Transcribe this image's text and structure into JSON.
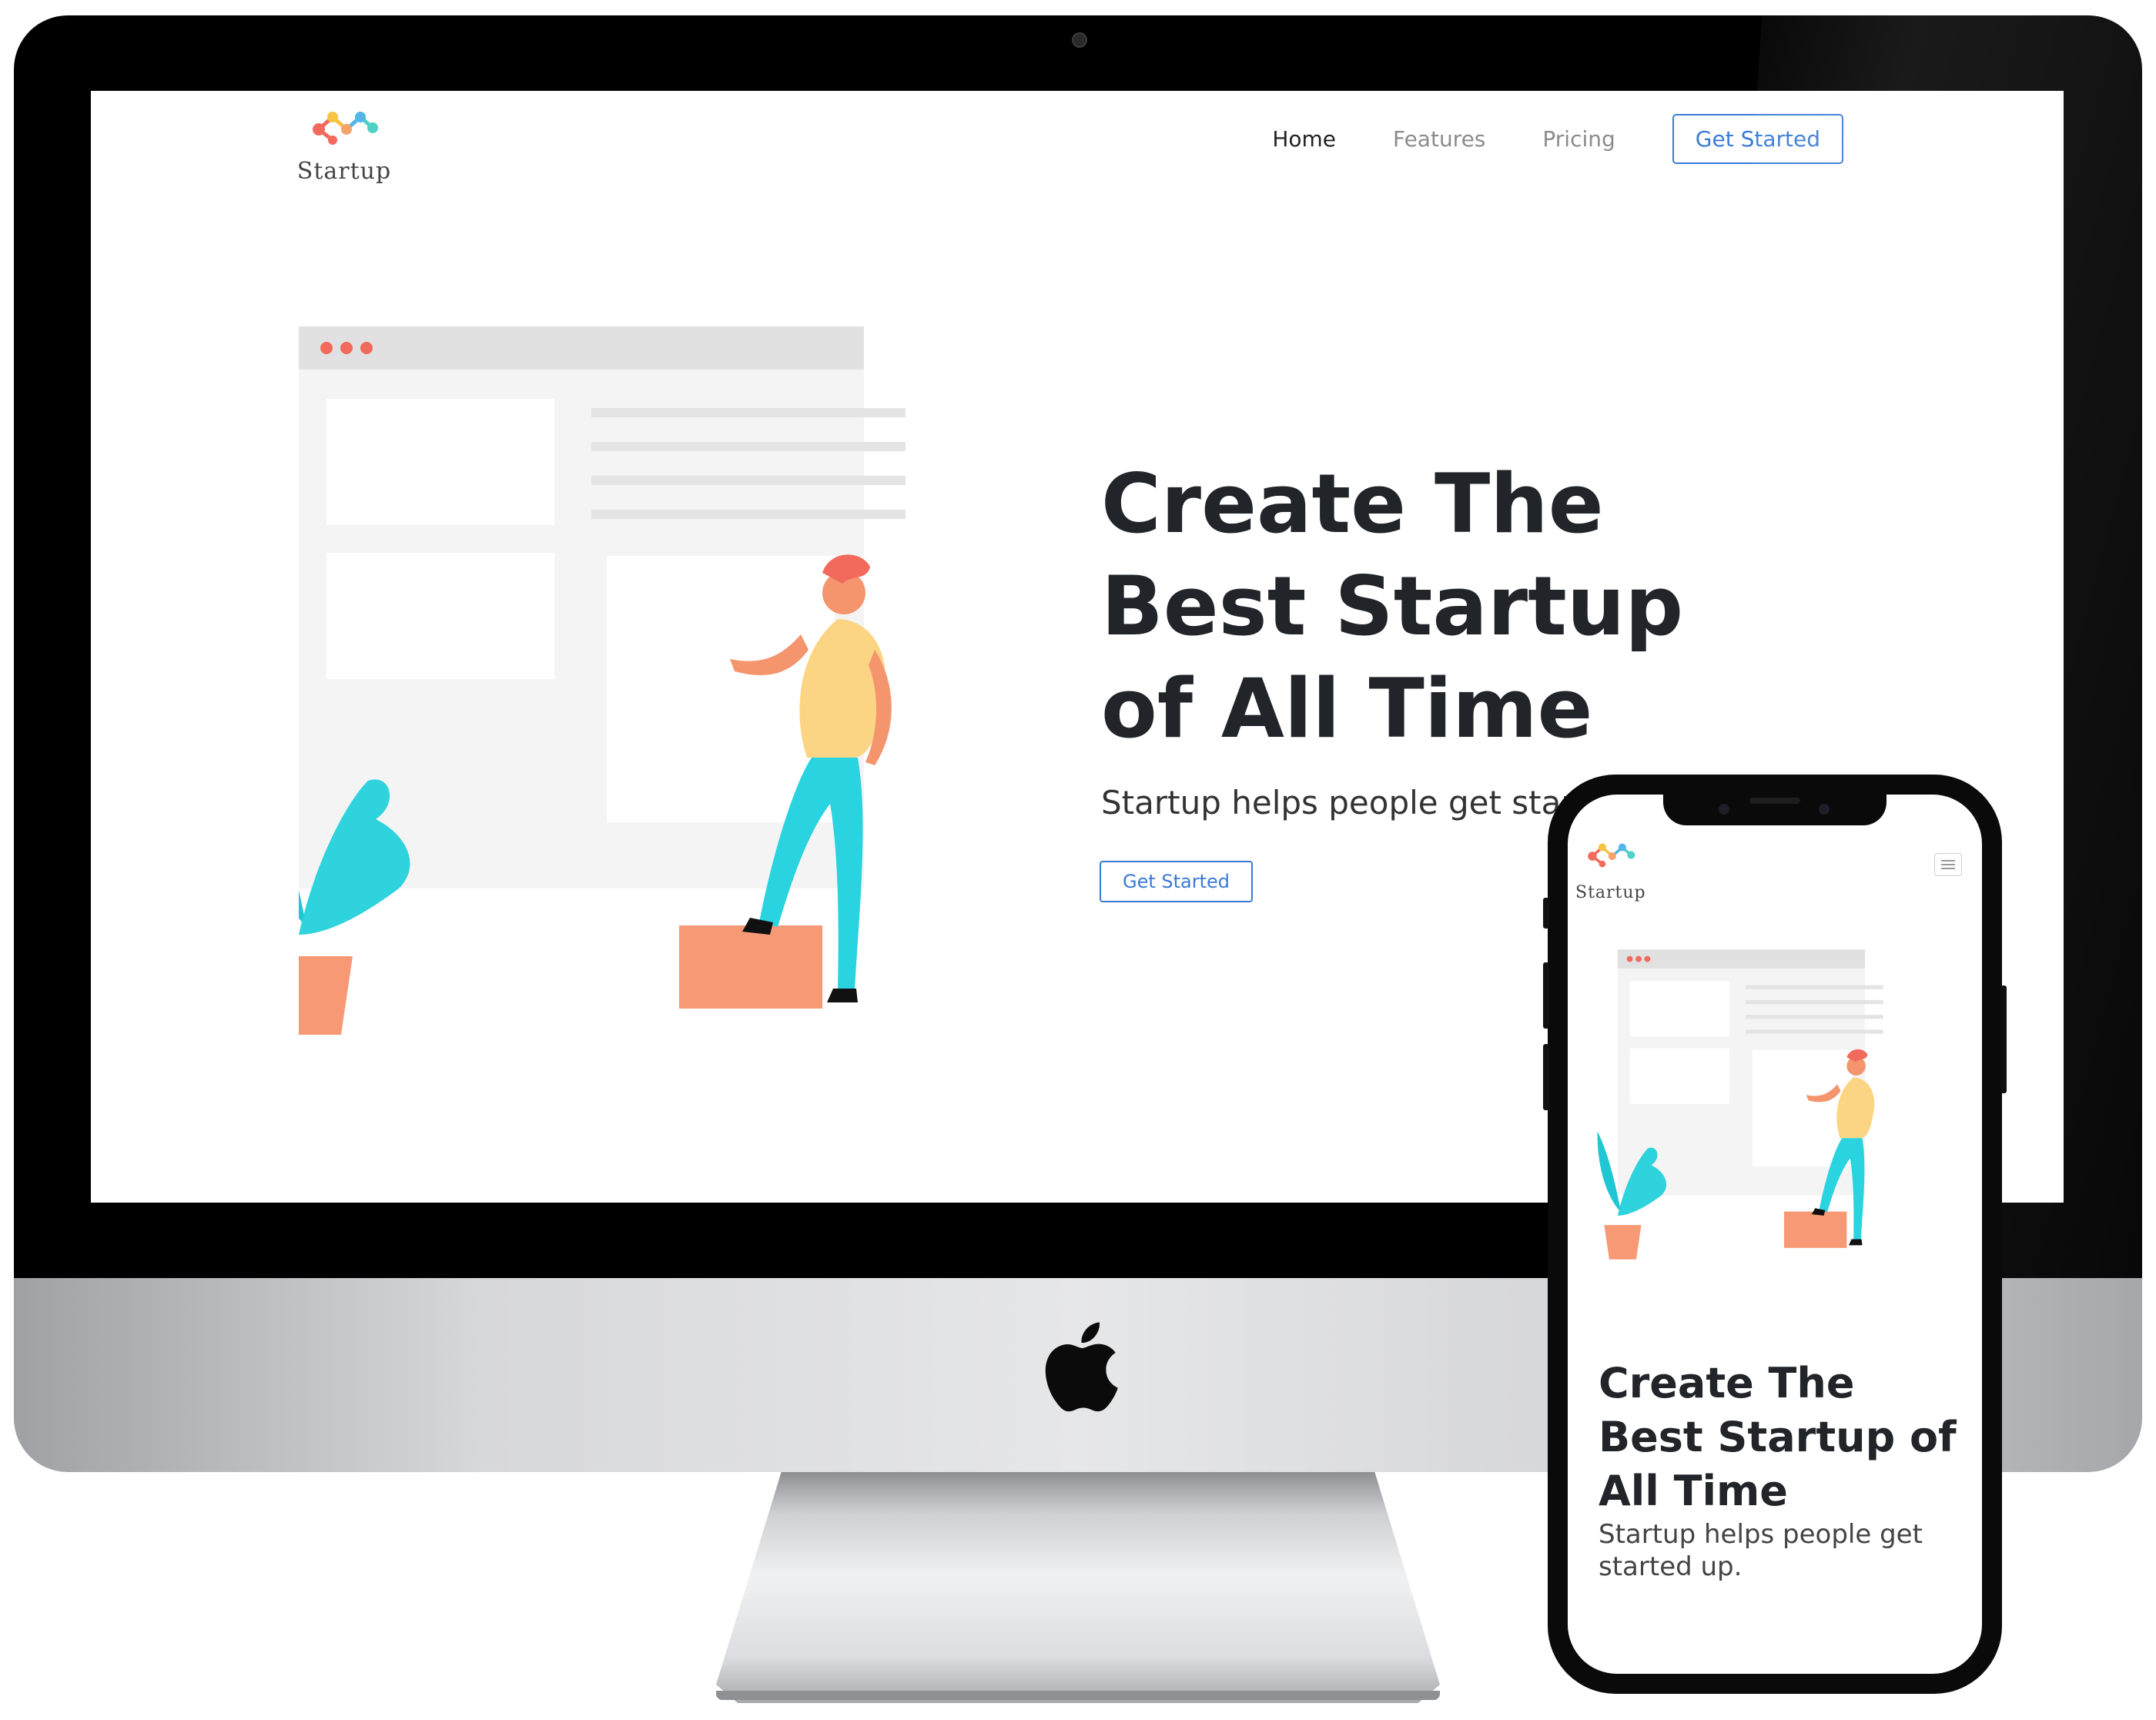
{
  "brand": {
    "logo_text": "Startup",
    "colors": {
      "accent": "#3a7bd5",
      "dot_red": "#f26a5b",
      "dot_yellow": "#f6c344",
      "dot_blue": "#52b6e8",
      "dot_teal": "#4fd1c5",
      "plant": "#1fc6d3",
      "figure_shirt": "#fbd583",
      "figure_pants": "#2ad3e0",
      "box": "#f79975"
    }
  },
  "desktop": {
    "nav": {
      "home": "Home",
      "features": "Features",
      "pricing": "Pricing",
      "cta": "Get Started"
    },
    "hero": {
      "title": "Create The Best Startup of All Time",
      "subtitle": "Startup helps people get started up.",
      "button": "Get Started"
    }
  },
  "mobile": {
    "menu_icon": "hamburger-icon",
    "hero": {
      "title": "Create The Best Startup of All Time",
      "subtitle": "Startup helps people get started up."
    }
  },
  "device": {
    "desktop_brand_icon": "apple-logo-icon"
  }
}
